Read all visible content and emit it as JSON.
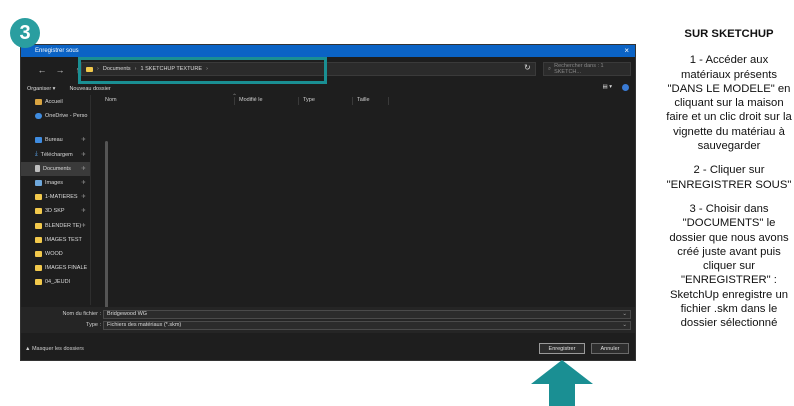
{
  "step_number": "3",
  "dialog": {
    "title": "Enregistrer sous",
    "close_symbol": "×",
    "address": {
      "crumbs": [
        "Documents",
        "1 SKETCHUP TEXTURE"
      ],
      "separator": "›",
      "dropdown_symbol": "⌄"
    },
    "nav": {
      "back": "←",
      "forward": "→",
      "up": "↑"
    },
    "search_placeholder": "Rechercher dans : 1 SKETCH...",
    "toolbar": {
      "organize": "Organiser ▾",
      "new_folder": "Nouveau dossier"
    },
    "sidebar": [
      {
        "label": "Accueil",
        "icon": "home-icon",
        "pinned": false,
        "active": false
      },
      {
        "label": "OneDrive - Perso",
        "icon": "cloud-icon",
        "pinned": false,
        "active": false
      },
      {
        "label": "Bureau",
        "icon": "desktop-icon",
        "pinned": true,
        "active": false
      },
      {
        "label": "Téléchargem",
        "icon": "download-icon",
        "pinned": true,
        "active": false
      },
      {
        "label": "Documents",
        "icon": "document-icon",
        "pinned": true,
        "active": true
      },
      {
        "label": "Images",
        "icon": "image-icon",
        "pinned": true,
        "active": false
      },
      {
        "label": "1-MATIERES",
        "icon": "folder-icon",
        "pinned": true,
        "active": false
      },
      {
        "label": "3D SKP",
        "icon": "folder-icon",
        "pinned": true,
        "active": false
      },
      {
        "label": "BLENDER TE)",
        "icon": "folder-icon",
        "pinned": true,
        "active": false
      },
      {
        "label": "IMAGES TEST",
        "icon": "folder-icon",
        "pinned": false,
        "active": false
      },
      {
        "label": "WOOD",
        "icon": "folder-icon",
        "pinned": false,
        "active": false
      },
      {
        "label": "IMAGES FINALE",
        "icon": "folder-icon",
        "pinned": false,
        "active": false
      },
      {
        "label": "04_JEUDI",
        "icon": "folder-icon",
        "pinned": false,
        "active": false
      }
    ],
    "pin_symbol": "✈",
    "columns": [
      "Nom",
      "Modifié le",
      "Type",
      "Taille"
    ],
    "filename_label": "Nom du fichier :",
    "filename_value": "Bridgewood WG",
    "type_label": "Type :",
    "type_value": "Fichiers des matériaux (*.skm)",
    "hide_folders": "▲ Masquer les dossiers",
    "save_button": "Enregistrer",
    "cancel_button": "Annuler"
  },
  "instructions": {
    "heading": "SUR SKETCHUP",
    "steps": [
      "1 - Accéder aux matériaux présents \"DANS LE MODELE\" en cliquant sur la maison faire et un clic droit sur la vignette du matériau à sauvegarder",
      "2 - Cliquer sur \"ENREGISTRER SOUS\"",
      "3 - Choisir dans \"DOCUMENTS\" le dossier que nous avons créé juste avant puis cliquer sur \"ENREGISTRER\" : SketchUp enregistre un fichier .skm dans le dossier sélectionné"
    ]
  },
  "colors": {
    "accent": "#1a8f93",
    "badge": "#2a9ea0",
    "titlebar": "#0b63c5",
    "dialog_bg": "#1e1e1e"
  }
}
